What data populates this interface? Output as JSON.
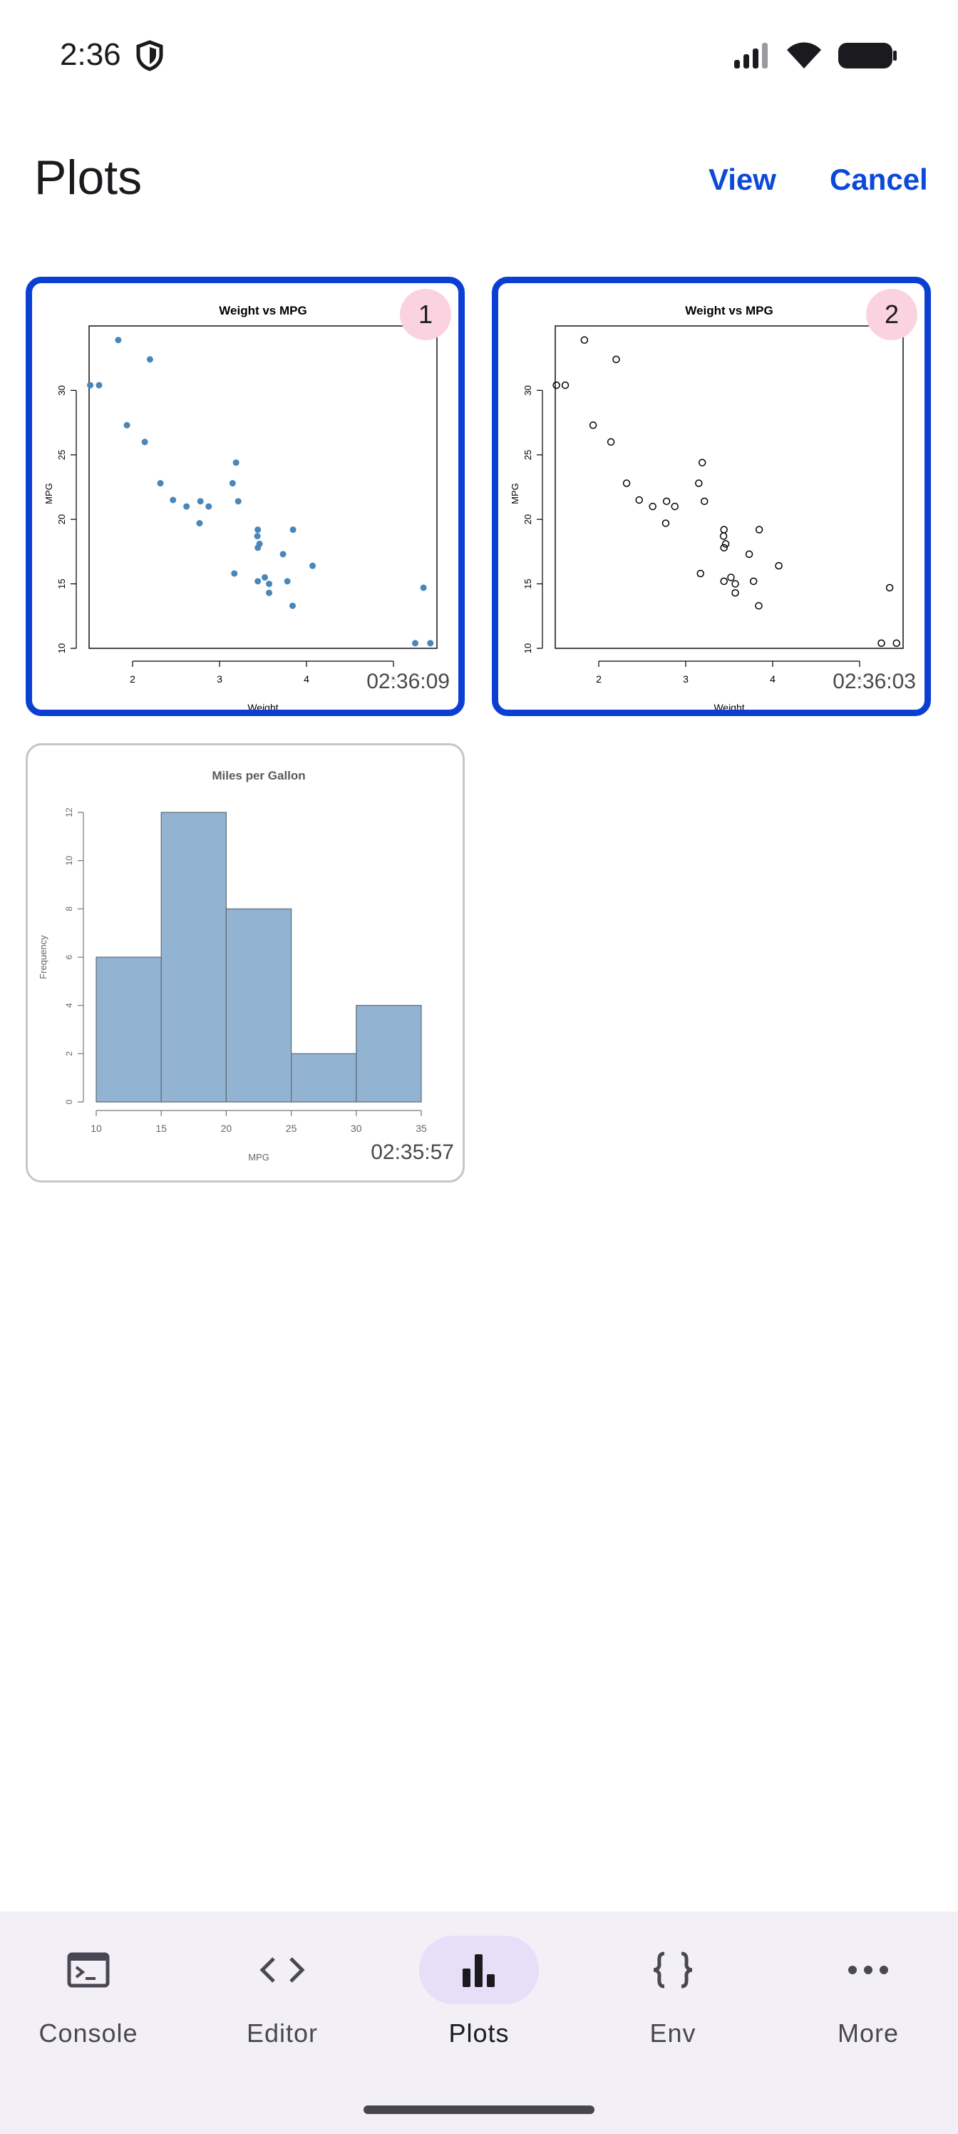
{
  "status_bar": {
    "time": "2:36",
    "icons": [
      "shield-icon",
      "signal-icon",
      "wifi-icon",
      "battery-icon"
    ]
  },
  "header": {
    "title": "Plots",
    "view_label": "View",
    "cancel_label": "Cancel"
  },
  "plots": [
    {
      "timestamp": "02:36:09",
      "selection_number": "1",
      "selected": true,
      "chart_data": {
        "type": "scatter",
        "title": "Weight vs MPG",
        "xlabel": "Weight",
        "ylabel": "MPG",
        "xlim": [
          1.5,
          5.5
        ],
        "ylim": [
          10,
          34
        ],
        "xticks": [
          "2",
          "3",
          "4",
          "5"
        ],
        "yticks": [
          "10",
          "15",
          "20",
          "25",
          "30"
        ],
        "marker": "filled",
        "color": "#4a86b8",
        "x": [
          1.513,
          1.615,
          1.835,
          1.935,
          2.14,
          2.2,
          2.32,
          2.465,
          2.62,
          2.77,
          2.78,
          2.875,
          3.15,
          3.17,
          3.19,
          3.215,
          3.435,
          3.44,
          3.44,
          3.44,
          3.46,
          3.52,
          3.57,
          3.57,
          3.73,
          3.78,
          3.84,
          3.845,
          4.07,
          5.25,
          5.345,
          5.424
        ],
        "y": [
          30.4,
          30.4,
          33.9,
          27.3,
          26.0,
          32.4,
          22.8,
          21.5,
          21.0,
          19.7,
          21.4,
          21.0,
          22.8,
          15.8,
          24.4,
          21.4,
          18.7,
          19.2,
          17.8,
          15.2,
          18.1,
          15.5,
          14.3,
          15.0,
          17.3,
          15.2,
          13.3,
          19.2,
          16.4,
          10.4,
          14.7,
          10.4
        ]
      }
    },
    {
      "timestamp": "02:36:03",
      "selection_number": "2",
      "selected": true,
      "chart_data": {
        "type": "scatter",
        "title": "Weight vs MPG",
        "xlabel": "Weight",
        "ylabel": "MPG",
        "xlim": [
          1.5,
          5.5
        ],
        "ylim": [
          10,
          34
        ],
        "xticks": [
          "2",
          "3",
          "4",
          "5"
        ],
        "yticks": [
          "10",
          "15",
          "20",
          "25",
          "30"
        ],
        "marker": "open",
        "color": "#000000",
        "x": [
          1.513,
          1.615,
          1.835,
          1.935,
          2.14,
          2.2,
          2.32,
          2.465,
          2.62,
          2.77,
          2.78,
          2.875,
          3.15,
          3.17,
          3.19,
          3.215,
          3.435,
          3.44,
          3.44,
          3.44,
          3.46,
          3.52,
          3.57,
          3.57,
          3.73,
          3.78,
          3.84,
          3.845,
          4.07,
          5.25,
          5.345,
          5.424
        ],
        "y": [
          30.4,
          30.4,
          33.9,
          27.3,
          26.0,
          32.4,
          22.8,
          21.5,
          21.0,
          19.7,
          21.4,
          21.0,
          22.8,
          15.8,
          24.4,
          21.4,
          18.7,
          19.2,
          17.8,
          15.2,
          18.1,
          15.5,
          14.3,
          15.0,
          17.3,
          15.2,
          13.3,
          19.2,
          16.4,
          10.4,
          14.7,
          10.4
        ]
      }
    },
    {
      "timestamp": "02:35:57",
      "selected": false,
      "chart_data": {
        "type": "bar",
        "title": "Miles per Gallon",
        "xlabel": "MPG",
        "ylabel": "Frequency",
        "bins": [
          [
            10,
            15
          ],
          [
            15,
            20
          ],
          [
            20,
            25
          ],
          [
            25,
            30
          ],
          [
            30,
            35
          ]
        ],
        "values": [
          6,
          12,
          8,
          2,
          4
        ],
        "xticks": [
          "10",
          "15",
          "20",
          "25",
          "30",
          "35"
        ],
        "yticks": [
          "0",
          "2",
          "4",
          "6",
          "8",
          "10",
          "12"
        ],
        "ylim": [
          0,
          12
        ],
        "color": "#92b3d2"
      }
    }
  ],
  "bottom_nav": {
    "items": [
      {
        "label": "Console",
        "icon": "console-icon",
        "active": false
      },
      {
        "label": "Editor",
        "icon": "code-icon",
        "active": false
      },
      {
        "label": "Plots",
        "icon": "bar-chart-icon",
        "active": true
      },
      {
        "label": "Env",
        "icon": "braces-icon",
        "active": false
      },
      {
        "label": "More",
        "icon": "more-icon",
        "active": false
      }
    ]
  }
}
